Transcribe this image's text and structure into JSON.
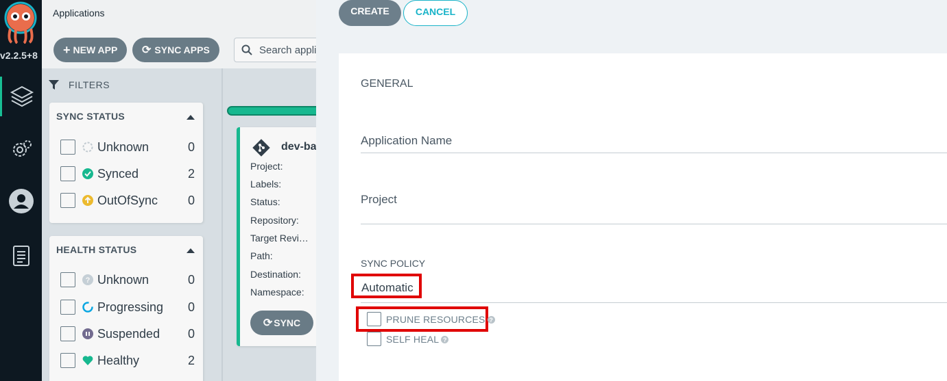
{
  "nav": {
    "version": "v2.2.5+8",
    "items": [
      "applications-icon",
      "settings-icon",
      "user-icon",
      "docs-icon"
    ]
  },
  "page": {
    "title": "Applications",
    "new_app": "NEW APP",
    "sync_apps": "SYNC APPS",
    "search_placeholder": "Search appli",
    "filters_label": "FILTERS",
    "sync_status": {
      "title": "SYNC STATUS",
      "items": [
        {
          "label": "Unknown",
          "count": "0",
          "icon": "unknown-circle-icon"
        },
        {
          "label": "Synced",
          "count": "2",
          "icon": "check-circle-icon"
        },
        {
          "label": "OutOfSync",
          "count": "0",
          "icon": "arrow-up-circle-icon"
        }
      ]
    },
    "health_status": {
      "title": "HEALTH STATUS",
      "items": [
        {
          "label": "Unknown",
          "count": "0",
          "icon": "question-circle-icon"
        },
        {
          "label": "Progressing",
          "count": "0",
          "icon": "progress-circle-icon"
        },
        {
          "label": "Suspended",
          "count": "0",
          "icon": "pause-circle-icon"
        },
        {
          "label": "Healthy",
          "count": "2",
          "icon": "heart-icon"
        }
      ]
    },
    "card": {
      "name": "dev-ba",
      "fields": [
        "Project:",
        "Labels:",
        "Status:",
        "Repository:",
        "Target Revi…",
        "Path:",
        "Destination:",
        "Namespace:"
      ],
      "sync_label": "SYNC"
    }
  },
  "panel": {
    "create": "CREATE",
    "cancel": "CANCEL",
    "general": "GENERAL",
    "app_name_label": "Application Name",
    "project_label": "Project",
    "sync_policy": "SYNC POLICY",
    "sync_policy_value": "Automatic",
    "prune": "PRUNE RESOURCES",
    "self_heal": "SELF HEAL"
  },
  "colors": {
    "nav_bg": "#0d1821",
    "accent_green": "#18be94",
    "accent_cyan": "#18b3c8",
    "button_gray": "#6d7f8b",
    "highlight_red": "#e00000"
  }
}
